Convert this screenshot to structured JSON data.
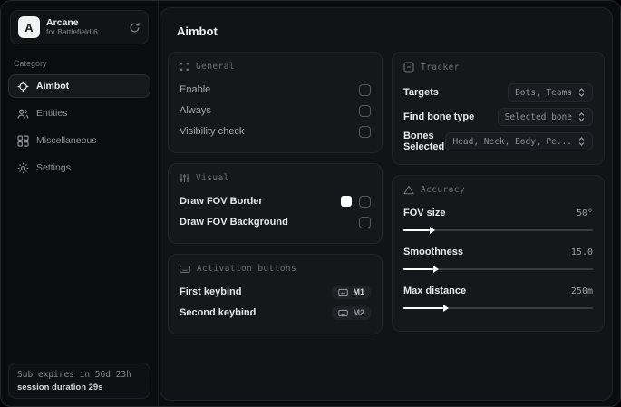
{
  "brand": {
    "logo_letter": "A",
    "name": "Arcane",
    "subtitle": "for Battlefield 6"
  },
  "sidebar": {
    "category_label": "Category",
    "items": [
      {
        "label": "Aimbot",
        "icon": "crosshair-icon",
        "active": true
      },
      {
        "label": "Entities",
        "icon": "entities-icon",
        "active": false
      },
      {
        "label": "Miscellaneous",
        "icon": "grid-icon",
        "active": false
      },
      {
        "label": "Settings",
        "icon": "gear-icon",
        "active": false
      }
    ],
    "sub_expires": "Sub expires in 56d 23h",
    "session_duration": "session duration 29s"
  },
  "main": {
    "title": "Aimbot",
    "general": {
      "title": "General",
      "rows": [
        {
          "label": "Enable",
          "checked": false
        },
        {
          "label": "Always",
          "checked": false
        },
        {
          "label": "Visibility check",
          "checked": false
        }
      ]
    },
    "visual": {
      "title": "Visual",
      "rows": [
        {
          "label": "Draw FOV Border",
          "swatch": "#ffffff",
          "checked": false
        },
        {
          "label": "Draw FOV Background",
          "checked": false
        }
      ]
    },
    "activation": {
      "title": "Activation buttons",
      "rows": [
        {
          "label": "First keybind",
          "key": "M1"
        },
        {
          "label": "Second keybind",
          "key": "M2"
        }
      ]
    },
    "tracker": {
      "title": "Tracker",
      "rows": [
        {
          "label": "Targets",
          "value": "Bots, Teams"
        },
        {
          "label": "Find bone type",
          "value": "Selected bone"
        },
        {
          "label": "Bones Selected",
          "value": "Head, Neck, Body, Pe..."
        }
      ]
    },
    "accuracy": {
      "title": "Accuracy",
      "rows": [
        {
          "label": "FOV size",
          "value": "50°",
          "fill": 14
        },
        {
          "label": "Smoothness",
          "value": "15.0",
          "fill": 16
        },
        {
          "label": "Max distance",
          "value": "250m",
          "fill": 21
        }
      ]
    }
  },
  "colors": {
    "fov_border_swatch": "#ffffff",
    "accent_text": "#eceded",
    "panel_bg": "#121316"
  }
}
